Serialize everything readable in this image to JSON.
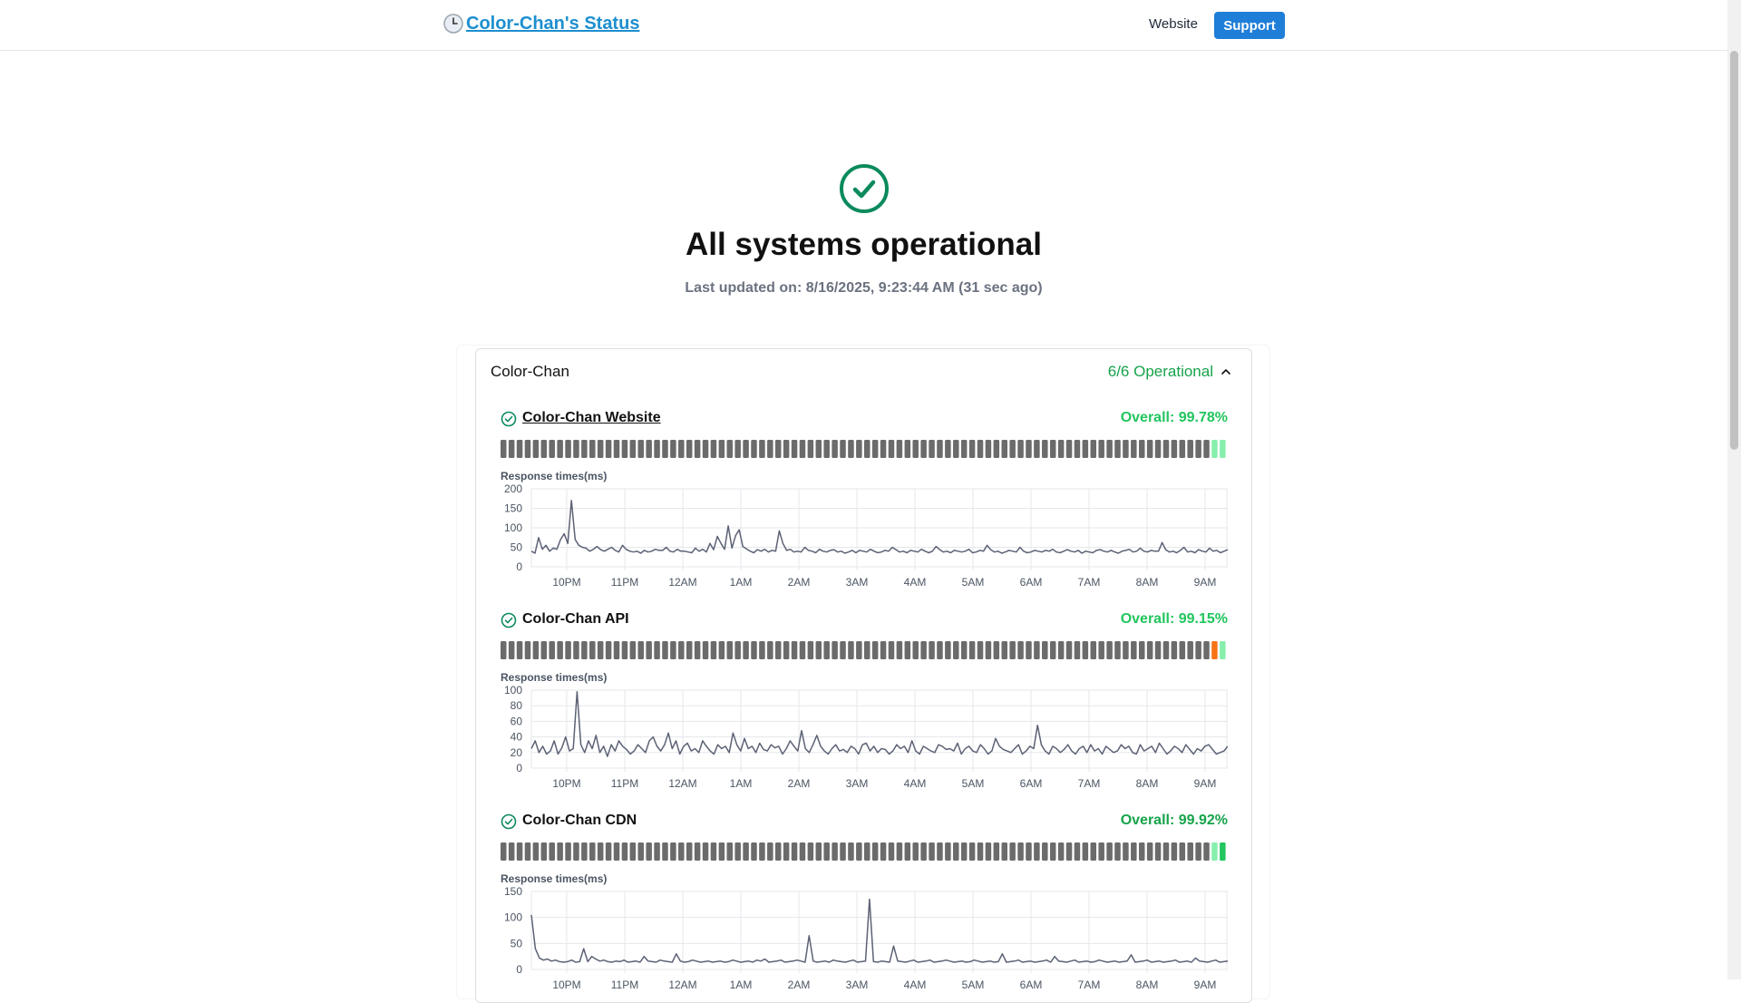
{
  "header": {
    "brand": "Color-Chan's Status",
    "nav_website": "Website",
    "nav_support": "Support"
  },
  "hero": {
    "title": "All systems operational",
    "updated": "Last updated on: 8/16/2025, 9:23:44 AM (31 sec ago)"
  },
  "group": {
    "name": "Color-Chan",
    "status": "6/6 Operational"
  },
  "colors": {
    "operational": "#16a34a",
    "overall_green": "#22c55e",
    "bar_gray": "#6b6b6b",
    "bar_lightgreen": "#86efac",
    "bar_green": "#22c55e",
    "bar_orange": "#f97316",
    "brand_link": "#1d8fcf",
    "support_button": "#1f7ed8",
    "line": "#5c6275"
  },
  "services": [
    {
      "name": "Color-Chan Website",
      "overall": "Overall: 99.78%",
      "overall_color": "#22c55e",
      "linked": true,
      "uptime_bars": [
        "gray",
        "gray",
        "gray",
        "gray",
        "gray",
        "gray",
        "gray",
        "gray",
        "gray",
        "gray",
        "gray",
        "gray",
        "gray",
        "gray",
        "gray",
        "gray",
        "gray",
        "gray",
        "gray",
        "gray",
        "gray",
        "gray",
        "gray",
        "gray",
        "gray",
        "gray",
        "gray",
        "gray",
        "gray",
        "gray",
        "gray",
        "gray",
        "gray",
        "gray",
        "gray",
        "gray",
        "gray",
        "gray",
        "gray",
        "gray",
        "gray",
        "gray",
        "gray",
        "gray",
        "gray",
        "gray",
        "gray",
        "gray",
        "gray",
        "gray",
        "gray",
        "gray",
        "gray",
        "gray",
        "gray",
        "gray",
        "gray",
        "gray",
        "gray",
        "gray",
        "gray",
        "gray",
        "gray",
        "gray",
        "gray",
        "gray",
        "gray",
        "gray",
        "gray",
        "gray",
        "gray",
        "gray",
        "gray",
        "gray",
        "gray",
        "gray",
        "gray",
        "gray",
        "gray",
        "gray",
        "gray",
        "gray",
        "gray",
        "gray",
        "gray",
        "gray",
        "gray",
        "gray",
        "lightgreen",
        "lightgreen"
      ]
    },
    {
      "name": "Color-Chan API",
      "overall": "Overall: 99.15%",
      "overall_color": "#22c55e",
      "linked": false,
      "uptime_bars": [
        "gray",
        "gray",
        "gray",
        "gray",
        "gray",
        "gray",
        "gray",
        "gray",
        "gray",
        "gray",
        "gray",
        "gray",
        "gray",
        "gray",
        "gray",
        "gray",
        "gray",
        "gray",
        "gray",
        "gray",
        "gray",
        "gray",
        "gray",
        "gray",
        "gray",
        "gray",
        "gray",
        "gray",
        "gray",
        "gray",
        "gray",
        "gray",
        "gray",
        "gray",
        "gray",
        "gray",
        "gray",
        "gray",
        "gray",
        "gray",
        "gray",
        "gray",
        "gray",
        "gray",
        "gray",
        "gray",
        "gray",
        "gray",
        "gray",
        "gray",
        "gray",
        "gray",
        "gray",
        "gray",
        "gray",
        "gray",
        "gray",
        "gray",
        "gray",
        "gray",
        "gray",
        "gray",
        "gray",
        "gray",
        "gray",
        "gray",
        "gray",
        "gray",
        "gray",
        "gray",
        "gray",
        "gray",
        "gray",
        "gray",
        "gray",
        "gray",
        "gray",
        "gray",
        "gray",
        "gray",
        "gray",
        "gray",
        "gray",
        "gray",
        "gray",
        "gray",
        "gray",
        "gray",
        "orange",
        "lightgreen"
      ]
    },
    {
      "name": "Color-Chan CDN",
      "overall": "Overall: 99.92%",
      "overall_color": "#16a34a",
      "linked": false,
      "uptime_bars": [
        "gray",
        "gray",
        "gray",
        "gray",
        "gray",
        "gray",
        "gray",
        "gray",
        "gray",
        "gray",
        "gray",
        "gray",
        "gray",
        "gray",
        "gray",
        "gray",
        "gray",
        "gray",
        "gray",
        "gray",
        "gray",
        "gray",
        "gray",
        "gray",
        "gray",
        "gray",
        "gray",
        "gray",
        "gray",
        "gray",
        "gray",
        "gray",
        "gray",
        "gray",
        "gray",
        "gray",
        "gray",
        "gray",
        "gray",
        "gray",
        "gray",
        "gray",
        "gray",
        "gray",
        "gray",
        "gray",
        "gray",
        "gray",
        "gray",
        "gray",
        "gray",
        "gray",
        "gray",
        "gray",
        "gray",
        "gray",
        "gray",
        "gray",
        "gray",
        "gray",
        "gray",
        "gray",
        "gray",
        "gray",
        "gray",
        "gray",
        "gray",
        "gray",
        "gray",
        "gray",
        "gray",
        "gray",
        "gray",
        "gray",
        "gray",
        "gray",
        "gray",
        "gray",
        "gray",
        "gray",
        "gray",
        "gray",
        "gray",
        "gray",
        "gray",
        "gray",
        "gray",
        "gray",
        "lightgreen",
        "green"
      ]
    }
  ],
  "chart_data": [
    {
      "type": "line",
      "title": "Response times(ms)",
      "ylim": [
        0,
        200
      ],
      "yticks": [
        0,
        50,
        100,
        150,
        200
      ],
      "xticks": [
        "10PM",
        "11PM",
        "12AM",
        "1AM",
        "2AM",
        "3AM",
        "4AM",
        "5AM",
        "6AM",
        "7AM",
        "8AM",
        "9AM"
      ],
      "grid": true,
      "series": [
        {
          "values": [
            40,
            35,
            75,
            45,
            55,
            40,
            48,
            45,
            70,
            85,
            60,
            170,
            70,
            55,
            50,
            48,
            40,
            45,
            52,
            44,
            40,
            45,
            50,
            42,
            38,
            55,
            45,
            40,
            38,
            40,
            35,
            42,
            38,
            40,
            45,
            42,
            42,
            50,
            40,
            38,
            45,
            40,
            40,
            38,
            36,
            48,
            40,
            45,
            38,
            60,
            44,
            78,
            60,
            45,
            105,
            48,
            80,
            95,
            52,
            46,
            40,
            36,
            44,
            40,
            45,
            38,
            42,
            40,
            92,
            60,
            42,
            45,
            38,
            40,
            38,
            50,
            42,
            40,
            36,
            45,
            40,
            38,
            42,
            44,
            38,
            40,
            35,
            38,
            42,
            36,
            42,
            40,
            38,
            45,
            40,
            36,
            38,
            42,
            40,
            50,
            44,
            38,
            40,
            36,
            42,
            40,
            38,
            45,
            40,
            36,
            40,
            52,
            44,
            38,
            40,
            36,
            42,
            40,
            38,
            40,
            45,
            36,
            38,
            42,
            40,
            55,
            44,
            38,
            40,
            35,
            38,
            42,
            40,
            38,
            50,
            40,
            36,
            38,
            42,
            40,
            38,
            42,
            40,
            45,
            38,
            36,
            40,
            44,
            40,
            38,
            42,
            35,
            40,
            38,
            36,
            42,
            44,
            40,
            38,
            42,
            38,
            35,
            40,
            42,
            45,
            38,
            40,
            48,
            40,
            38,
            42,
            40,
            40,
            62,
            44,
            38,
            40,
            36,
            42,
            50,
            38,
            40,
            36,
            44,
            40,
            38,
            48,
            40,
            42,
            36,
            40,
            44
          ]
        }
      ]
    },
    {
      "type": "line",
      "title": "Response times(ms)",
      "ylim": [
        0,
        100
      ],
      "yticks": [
        0,
        20,
        40,
        60,
        80,
        100
      ],
      "xticks": [
        "10PM",
        "11PM",
        "12AM",
        "1AM",
        "2AM",
        "3AM",
        "4AM",
        "5AM",
        "6AM",
        "7AM",
        "8AM",
        "9AM"
      ],
      "grid": true,
      "series": [
        {
          "values": [
            25,
            35,
            20,
            28,
            18,
            22,
            35,
            18,
            26,
            40,
            22,
            25,
            98,
            30,
            20,
            35,
            25,
            42,
            20,
            28,
            15,
            30,
            22,
            35,
            28,
            24,
            18,
            22,
            30,
            25,
            20,
            35,
            40,
            28,
            22,
            30,
            45,
            25,
            35,
            18,
            28,
            32,
            22,
            25,
            20,
            35,
            28,
            22,
            18,
            30,
            25,
            28,
            20,
            45,
            30,
            22,
            38,
            25,
            28,
            20,
            32,
            24,
            22,
            30,
            26,
            28,
            18,
            25,
            35,
            28,
            22,
            48,
            25,
            20,
            30,
            42,
            28,
            22,
            18,
            25,
            30,
            22,
            24,
            20,
            28,
            25,
            18,
            30,
            32,
            22,
            28,
            20,
            25,
            24,
            18,
            22,
            30,
            25,
            28,
            20,
            35,
            22,
            18,
            28,
            25,
            22,
            20,
            30,
            28,
            24,
            25,
            22,
            32,
            18,
            25,
            28,
            22,
            20,
            30,
            25,
            18,
            22,
            38,
            28,
            24,
            22,
            20,
            25,
            30,
            18,
            22,
            28,
            25,
            55,
            30,
            22,
            18,
            28,
            25,
            20,
            24,
            30,
            22,
            18,
            25,
            28,
            20,
            30,
            22,
            25,
            18,
            28,
            24,
            20,
            22,
            30,
            25,
            28,
            20,
            18,
            30,
            22,
            25,
            28,
            20,
            32,
            25,
            18,
            22,
            28,
            25,
            20,
            30,
            24,
            18,
            25,
            22,
            28,
            30,
            24,
            18,
            20,
            22,
            28
          ]
        }
      ]
    },
    {
      "type": "line",
      "title": "Response times(ms)",
      "ylim": [
        0,
        150
      ],
      "yticks": [
        0,
        50,
        100,
        150
      ],
      "xticks": [
        "10PM",
        "11PM",
        "12AM",
        "1AM",
        "2AM",
        "3AM",
        "4AM",
        "5AM",
        "6AM",
        "7AM",
        "8AM",
        "9AM"
      ],
      "grid": true,
      "series": [
        {
          "values": [
            105,
            40,
            22,
            18,
            20,
            16,
            18,
            15,
            14,
            15,
            18,
            14,
            15,
            40,
            15,
            25,
            20,
            16,
            18,
            15,
            14,
            16,
            15,
            18,
            14,
            15,
            16,
            14,
            25,
            16,
            15,
            14,
            18,
            16,
            15,
            14,
            30,
            16,
            14,
            15,
            18,
            16,
            14,
            15,
            16,
            14,
            15,
            16,
            14,
            15,
            18,
            16,
            14,
            15,
            16,
            14,
            18,
            16,
            20,
            14,
            15,
            16,
            18,
            14,
            15,
            16,
            18,
            16,
            14,
            65,
            16,
            14,
            15,
            16,
            14,
            18,
            16,
            15,
            14,
            16,
            18,
            14,
            15,
            16,
            135,
            15,
            14,
            16,
            15,
            14,
            45,
            16,
            15,
            14,
            16,
            18,
            14,
            15,
            16,
            18,
            14,
            15,
            16,
            18,
            16,
            14,
            15,
            16,
            14,
            15,
            18,
            16,
            14,
            15,
            16,
            14,
            15,
            30,
            14,
            15,
            16,
            18,
            14,
            15,
            16,
            14,
            15,
            16,
            18,
            14,
            25,
            16,
            15,
            14,
            16,
            18,
            14,
            15,
            16,
            14,
            15,
            18,
            16,
            14,
            15,
            16,
            14,
            15,
            16,
            28,
            14,
            15,
            16,
            18,
            14,
            15,
            16,
            14,
            15,
            16,
            18,
            14,
            15,
            16,
            14,
            22,
            16,
            15,
            14,
            16,
            18,
            14,
            15,
            16
          ]
        }
      ]
    }
  ]
}
